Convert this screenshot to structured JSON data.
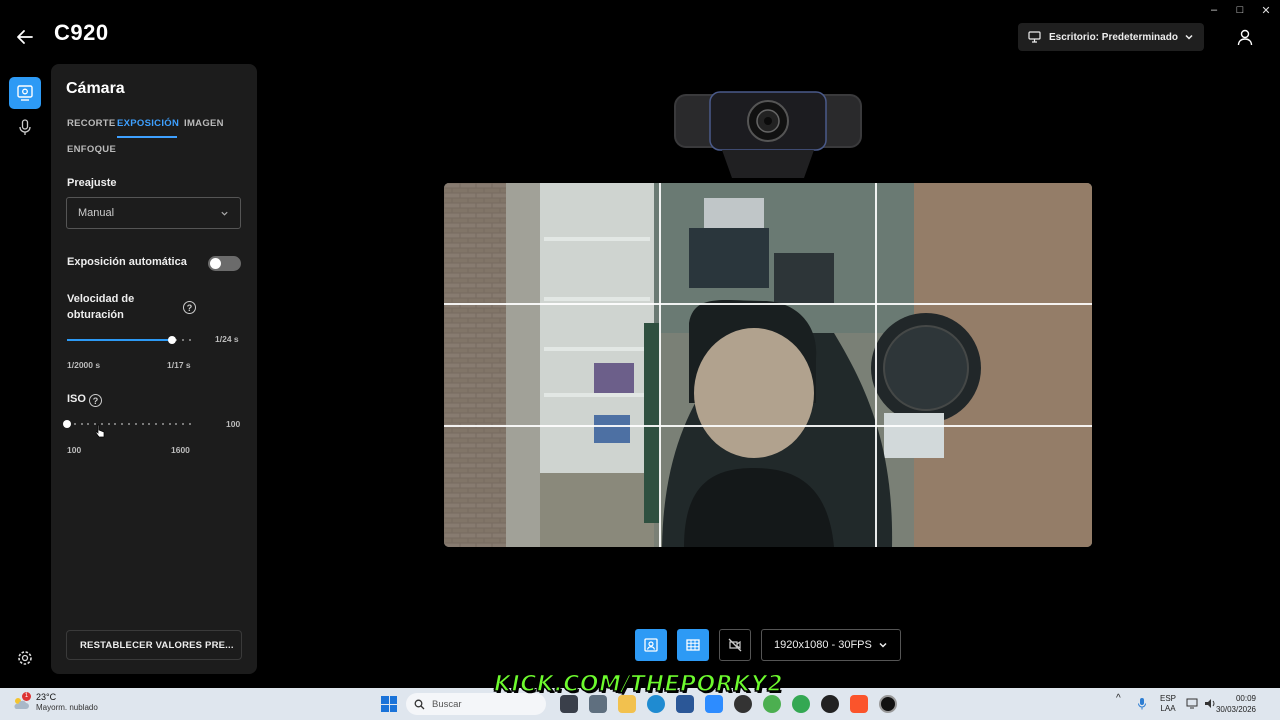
{
  "app": {
    "title": "C920",
    "window_controls": [
      "–",
      "□",
      "✕"
    ]
  },
  "header": {
    "profile_dropdown": "Escritorio: Predeterminado"
  },
  "panel": {
    "title": "Cámara",
    "tabs": [
      {
        "label": "RECORTE",
        "active": false
      },
      {
        "label": "EXPOSICIÓN",
        "active": true
      },
      {
        "label": "IMAGEN",
        "active": false
      },
      {
        "label": "ENFOQUE",
        "active": false
      }
    ],
    "preset_label": "Preajuste",
    "preset_value": "Manual",
    "auto_exposure_label": "Exposición automática",
    "auto_exposure_on": false,
    "shutter": {
      "label": "Velocidad de obturación",
      "value_text": "1/24 s",
      "min_label": "1/2000 s",
      "max_label": "1/17 s",
      "level": 0.85
    },
    "iso": {
      "label": "ISO",
      "value_text": "100",
      "min_label": "100",
      "max_label": "1600",
      "level": 0.0
    },
    "reset_button": "RESTABLECER VALORES PRE..."
  },
  "controls": {
    "resolution": "1920x1080 - 30FPS"
  },
  "taskbar": {
    "weather_temp": "23°C",
    "weather_desc": "Mayorm. nublado",
    "notification_count": "1",
    "search_placeholder": "Buscar",
    "language": "ESP",
    "layout": "LAA",
    "time": "00:09",
    "date": "30/03/2026"
  },
  "overlay": {
    "watermark": "KICK.COM/THEPORKY2"
  },
  "colors": {
    "accent": "#2d9af5",
    "tab_active": "#3ea0ff",
    "panel_bg": "#1c1c1c"
  }
}
